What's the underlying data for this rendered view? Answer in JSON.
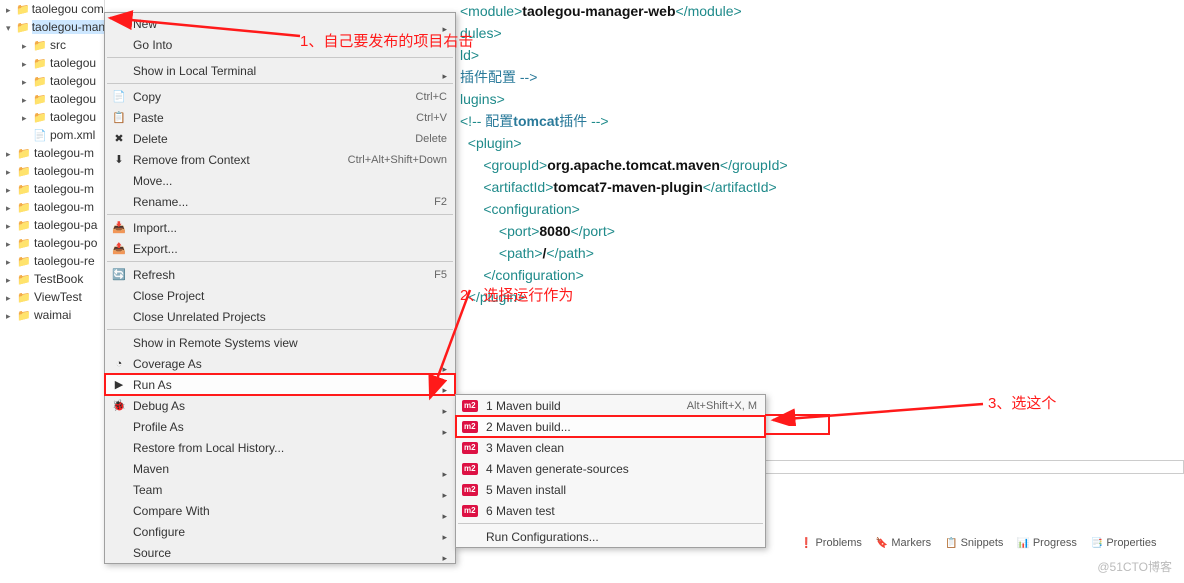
{
  "tree": {
    "items": [
      {
        "level": 1,
        "label": "taolegou commons",
        "type": "proj",
        "exp": ""
      },
      {
        "level": 1,
        "label": "taolegou-manager",
        "type": "proj",
        "exp": "open",
        "selected": true
      },
      {
        "level": 2,
        "label": "src",
        "type": "folder",
        "exp": ""
      },
      {
        "level": 2,
        "label": "taolegou",
        "type": "folder",
        "exp": ""
      },
      {
        "level": 2,
        "label": "taolegou",
        "type": "folder",
        "exp": ""
      },
      {
        "level": 2,
        "label": "taolegou",
        "type": "folder",
        "exp": ""
      },
      {
        "level": 2,
        "label": "taolegou",
        "type": "folder",
        "exp": ""
      },
      {
        "level": 2,
        "label": "pom.xml",
        "type": "file",
        "exp": ""
      },
      {
        "level": 1,
        "label": "taolegou-m",
        "type": "proj",
        "exp": ""
      },
      {
        "level": 1,
        "label": "taolegou-m",
        "type": "proj",
        "exp": ""
      },
      {
        "level": 1,
        "label": "taolegou-m",
        "type": "proj",
        "exp": ""
      },
      {
        "level": 1,
        "label": "taolegou-m",
        "type": "proj",
        "exp": ""
      },
      {
        "level": 1,
        "label": "taolegou-pa",
        "type": "proj",
        "exp": ""
      },
      {
        "level": 1,
        "label": "taolegou-po",
        "type": "proj",
        "exp": ""
      },
      {
        "level": 1,
        "label": "taolegou-re",
        "type": "proj",
        "exp": ""
      },
      {
        "level": 1,
        "label": "TestBook",
        "type": "proj",
        "exp": ""
      },
      {
        "level": 1,
        "label": "ViewTest",
        "type": "proj",
        "exp": ""
      },
      {
        "level": 1,
        "label": "waimai",
        "type": "proj",
        "exp": ""
      }
    ]
  },
  "context_menu": [
    {
      "label": "New",
      "arrow": true
    },
    {
      "label": "Go Into"
    },
    {
      "sep": true
    },
    {
      "label": "Show in Local Terminal",
      "arrow": true
    },
    {
      "sep": true
    },
    {
      "label": "Copy",
      "shortcut": "Ctrl+C",
      "icon": "📄"
    },
    {
      "label": "Paste",
      "shortcut": "Ctrl+V",
      "icon": "📋"
    },
    {
      "label": "Delete",
      "shortcut": "Delete",
      "icon": "✖"
    },
    {
      "label": "Remove from Context",
      "shortcut": "Ctrl+Alt+Shift+Down",
      "icon": "⬇"
    },
    {
      "label": "Move..."
    },
    {
      "label": "Rename...",
      "shortcut": "F2"
    },
    {
      "sep": true
    },
    {
      "label": "Import...",
      "icon": "📥"
    },
    {
      "label": "Export...",
      "icon": "📤"
    },
    {
      "sep": true
    },
    {
      "label": "Refresh",
      "shortcut": "F5",
      "icon": "🔄"
    },
    {
      "label": "Close Project"
    },
    {
      "label": "Close Unrelated Projects"
    },
    {
      "sep": true
    },
    {
      "label": "Show in Remote Systems view"
    },
    {
      "label": "Coverage As",
      "arrow": true,
      "icon": "◔"
    },
    {
      "label": "Run As",
      "arrow": true,
      "icon": "▶",
      "highlight": true
    },
    {
      "label": "Debug As",
      "arrow": true,
      "icon": "🐞"
    },
    {
      "label": "Profile As",
      "arrow": true
    },
    {
      "label": "Restore from Local History..."
    },
    {
      "label": "Maven",
      "arrow": true
    },
    {
      "label": "Team",
      "arrow": true
    },
    {
      "label": "Compare With",
      "arrow": true
    },
    {
      "label": "Configure",
      "arrow": true
    },
    {
      "label": "Source",
      "arrow": true
    }
  ],
  "submenu": [
    {
      "m2": true,
      "label": "1 Maven build",
      "shortcut": "Alt+Shift+X, M"
    },
    {
      "m2": true,
      "label": "2 Maven build...",
      "highlight": true
    },
    {
      "m2": true,
      "label": "3 Maven clean"
    },
    {
      "m2": true,
      "label": "4 Maven generate-sources"
    },
    {
      "m2": true,
      "label": "5 Maven install"
    },
    {
      "m2": true,
      "label": "6 Maven test"
    },
    {
      "sep": true
    },
    {
      "label": "Run Configurations..."
    }
  ],
  "annotations": {
    "a1": "1、自己要发布的项目右击",
    "a2": "2、选择运行作为",
    "a3": "3、选这个"
  },
  "editor": {
    "lines": [
      {
        "html": "<span class='tag'>&lt;module&gt;</span><span class='text'>taolegou-manager-web</span><span class='tag'>&lt;/module&gt;</span>"
      },
      {
        "html": "<span class='tag'>dules&gt;</span>"
      },
      {
        "html": "<span class='tag'>ld&gt;</span>"
      },
      {
        "html": "<span class='cmt-zh'>插件配置 --&gt;</span>"
      },
      {
        "html": "<span class='tag'>lugins&gt;</span>"
      },
      {
        "html": "<span class='cmt'>&lt;!-- </span><span class='cmt-zh'>配置</span><span class='cmt' style='color:#2a7a9a;font-weight:600'>tomcat</span><span class='cmt-zh'>插件 </span><span class='cmt'>--&gt;</span>"
      },
      {
        "html": "  <span class='tag'>&lt;plugin&gt;</span>"
      },
      {
        "html": "      <span class='tag'>&lt;groupId&gt;</span><span class='text'>org.apache.tomcat.maven</span><span class='tag'>&lt;/groupId&gt;</span>"
      },
      {
        "html": "      <span class='tag'>&lt;artifactId&gt;</span><span class='text'>tomcat7-maven-plugin</span><span class='tag'>&lt;/artifactId&gt;</span>"
      },
      {
        "html": "      <span class='tag'>&lt;configuration&gt;</span>"
      },
      {
        "html": "          <span class='tag'>&lt;port&gt;</span><span class='text'>8080</span><span class='tag'>&lt;/port&gt;</span>"
      },
      {
        "html": "          <span class='tag'>&lt;path&gt;</span><span class='text'>/</span><span class='tag'>&lt;/path&gt;</span>"
      },
      {
        "html": "      <span class='tag'>&lt;/configuration&gt;</span>"
      },
      {
        "html": "  <span class='tag'>&lt;/plugin&gt;</span>"
      }
    ]
  },
  "bottom_tabs": [
    {
      "icon": "❗",
      "label": "Problems"
    },
    {
      "icon": "🔖",
      "label": "Markers"
    },
    {
      "icon": "📋",
      "label": "Snippets"
    },
    {
      "icon": "📊",
      "label": "Progress"
    },
    {
      "icon": "📑",
      "label": "Properties"
    }
  ],
  "watermark": "@51CTO博客"
}
